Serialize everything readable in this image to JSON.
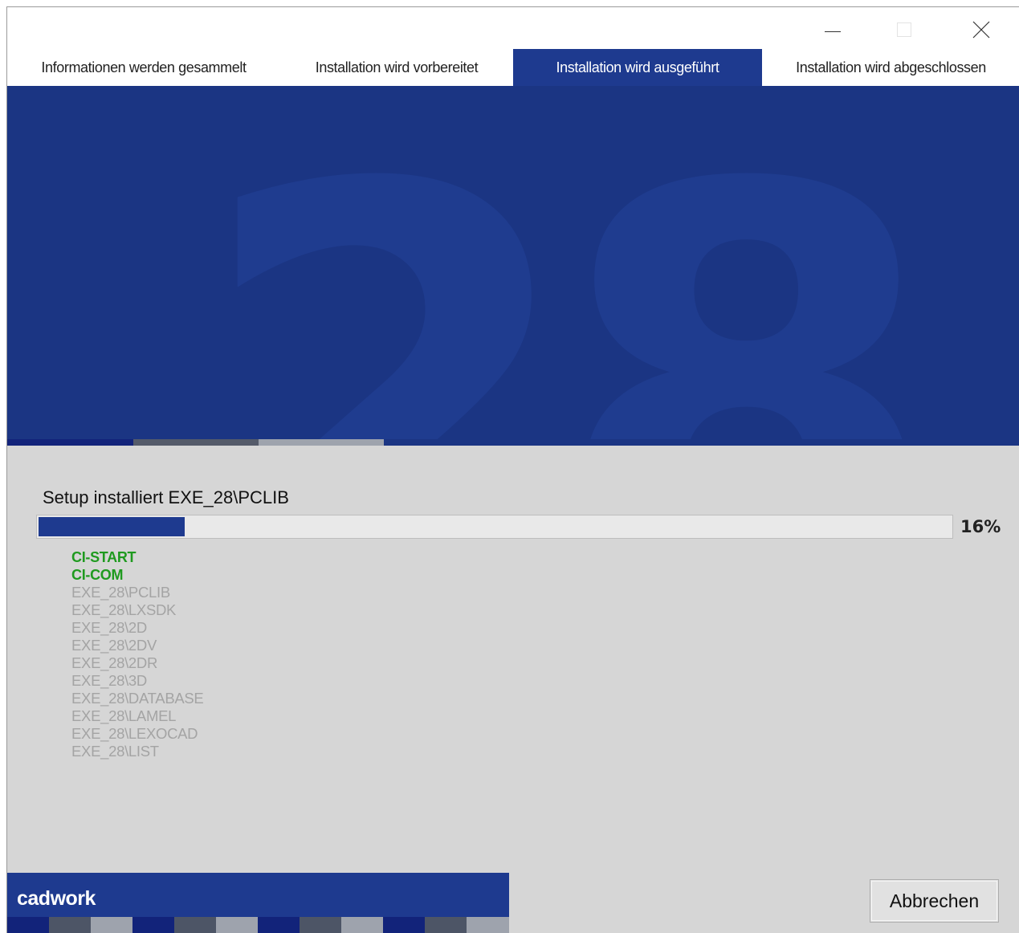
{
  "window": {
    "controls": {
      "minimize_icon": "minimize-icon",
      "maximize_icon": "maximize-icon",
      "close_icon": "close-icon"
    }
  },
  "tabs": [
    {
      "label": "Informationen werden gesammelt",
      "active": false
    },
    {
      "label": "Installation wird vorbereitet",
      "active": false
    },
    {
      "label": "Installation wird ausgeführt",
      "active": true
    },
    {
      "label": "Installation wird abgeschlossen",
      "active": false
    }
  ],
  "banner": {
    "graphic_text": "28",
    "background_color": "#1b3583"
  },
  "install": {
    "status_text": "Setup installiert EXE_28\\PCLIB",
    "progress_percent": 16,
    "progress_label": "16%",
    "components": [
      {
        "name": "CI-START",
        "state": "done"
      },
      {
        "name": "CI-COM",
        "state": "done"
      },
      {
        "name": "EXE_28\\PCLIB",
        "state": "pending"
      },
      {
        "name": "EXE_28\\LXSDK",
        "state": "pending"
      },
      {
        "name": "EXE_28\\2D",
        "state": "pending"
      },
      {
        "name": "EXE_28\\2DV",
        "state": "pending"
      },
      {
        "name": "EXE_28\\2DR",
        "state": "pending"
      },
      {
        "name": "EXE_28\\3D",
        "state": "pending"
      },
      {
        "name": "EXE_28\\DATABASE",
        "state": "pending"
      },
      {
        "name": "EXE_28\\LAMEL",
        "state": "pending"
      },
      {
        "name": "EXE_28\\LEXOCAD",
        "state": "pending"
      },
      {
        "name": "EXE_28\\LIST",
        "state": "pending"
      }
    ]
  },
  "footer": {
    "brand": "cadwork",
    "cancel_label": "Abbrechen"
  },
  "colors": {
    "accent": "#1e3a8f",
    "done": "#1f9a1f",
    "pending": "#a4a4a4",
    "panel": "#d6d6d6"
  }
}
